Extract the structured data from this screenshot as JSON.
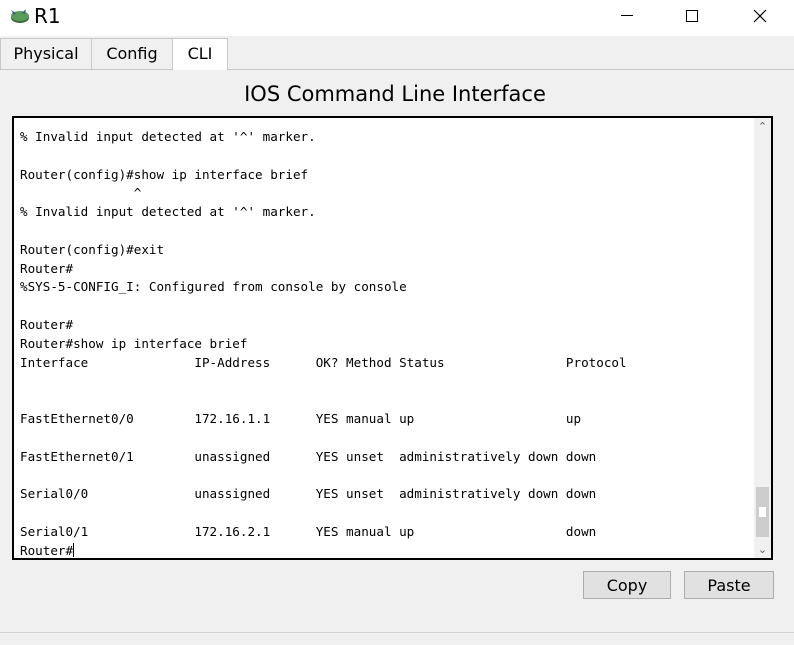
{
  "window": {
    "title": "R1",
    "icon": "router-icon",
    "minimize_icon": "minimize-icon",
    "maximize_icon": "maximize-icon",
    "close_icon": "close-icon"
  },
  "tabs": [
    {
      "label": "Physical"
    },
    {
      "label": "Config"
    },
    {
      "label": "CLI",
      "active": true
    }
  ],
  "cli": {
    "heading": "IOS Command Line Interface",
    "lines": [
      "% Invalid input detected at '^' marker.",
      "",
      "Router(config)#show ip interface brief",
      "               ^",
      "% Invalid input detected at '^' marker.",
      "",
      "Router(config)#exit",
      "Router#",
      "%SYS-5-CONFIG_I: Configured from console by console",
      "",
      "Router#",
      "Router#show ip interface brief",
      "Interface              IP-Address      OK? Method Status                Protocol",
      "",
      "",
      "FastEthernet0/0        172.16.1.1      YES manual up                    up",
      "",
      "FastEthernet0/1        unassigned      YES unset  administratively down down",
      "",
      "Serial0/0              unassigned      YES unset  administratively down down",
      "",
      "Serial0/1              172.16.2.1      YES manual up                    down",
      "Router#"
    ]
  },
  "buttons": {
    "copy": "Copy",
    "paste": "Paste"
  },
  "scrollbar": {
    "up_icon": "chevron-up-icon",
    "down_icon": "chevron-down-icon"
  }
}
